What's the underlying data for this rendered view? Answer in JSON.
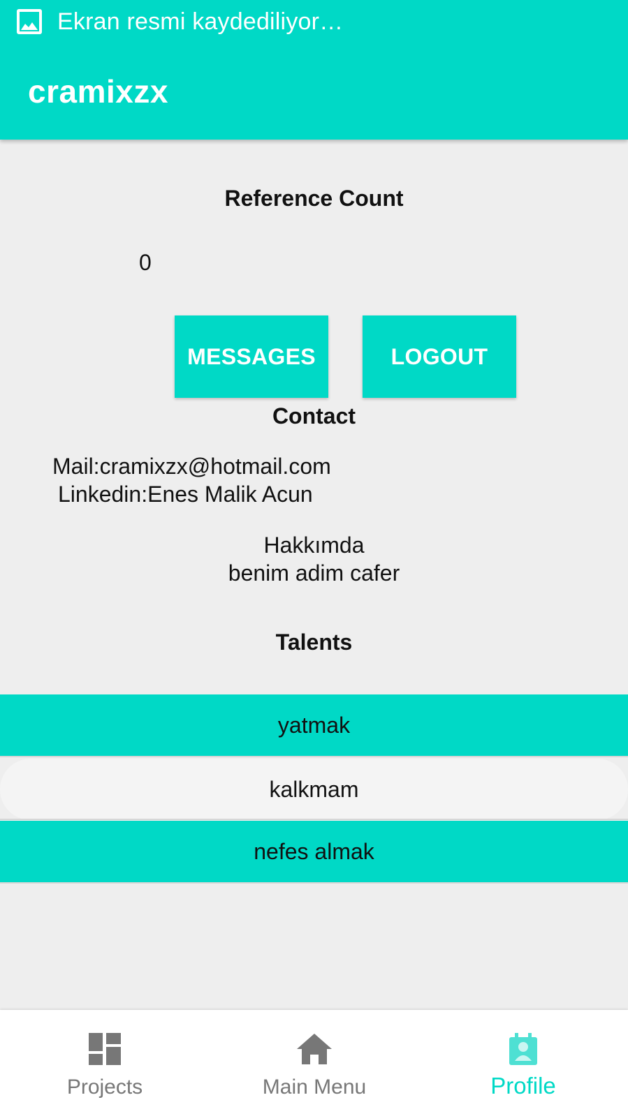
{
  "status_bar": {
    "icon": "screenshot-image-icon",
    "text": "Ekran resmi kaydediliyor…"
  },
  "app_bar": {
    "title": "cramixzx"
  },
  "reference": {
    "heading": "Reference Count",
    "value": "0"
  },
  "buttons": {
    "messages": "MESSAGES",
    "logout": "LOGOUT"
  },
  "contact": {
    "heading": "Contact",
    "mail": "Mail:cramixzx@hotmail.com",
    "linkedin": "Linkedin:Enes Malik Acun"
  },
  "about": {
    "heading": "Hakkımda",
    "text": "benim adim cafer"
  },
  "talents": {
    "heading": "Talents",
    "items": [
      {
        "label": "yatmak",
        "style": "teal"
      },
      {
        "label": "kalkmam",
        "style": "light"
      },
      {
        "label": "nefes almak",
        "style": "teal"
      }
    ]
  },
  "bottom_nav": {
    "items": [
      {
        "label": "Projects",
        "icon": "dashboard-icon",
        "active": false
      },
      {
        "label": "Main Menu",
        "icon": "home-icon",
        "active": false
      },
      {
        "label": "Profile",
        "icon": "profile-badge-icon",
        "active": true
      }
    ]
  },
  "colors": {
    "accent": "#00d9c6",
    "background": "#eeeeee",
    "inactive_nav": "#777777"
  }
}
